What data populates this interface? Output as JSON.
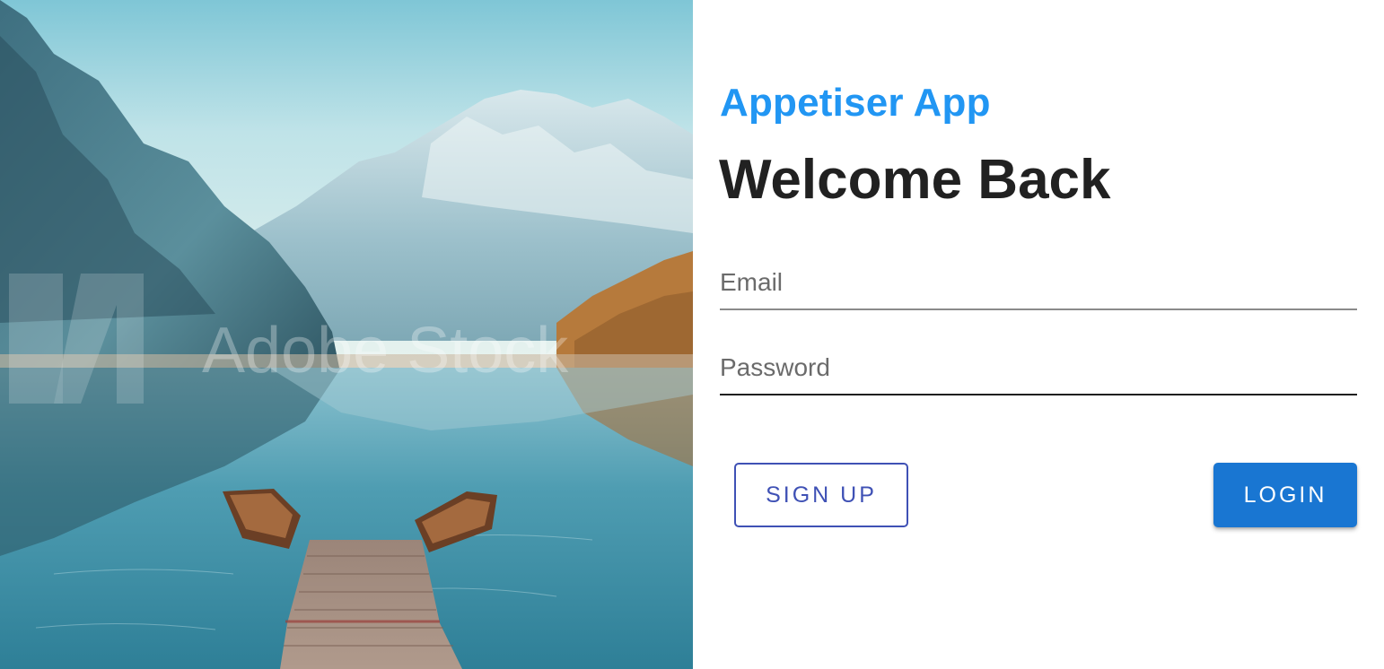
{
  "hero": {
    "image_description_icon": "mountain-lake-photo",
    "watermark_text": "Adobe Stock"
  },
  "login": {
    "app_name": "Appetiser App",
    "heading": "Welcome Back",
    "email": {
      "placeholder": "Email",
      "value": ""
    },
    "password": {
      "placeholder": "Password",
      "value": ""
    },
    "signup_label": "SIGN UP",
    "login_label": "LOGIN"
  },
  "colors": {
    "app_name": "#2196f3",
    "heading": "#212121",
    "signup_outline": "#3f51b5",
    "login_fill": "#1976d2"
  }
}
